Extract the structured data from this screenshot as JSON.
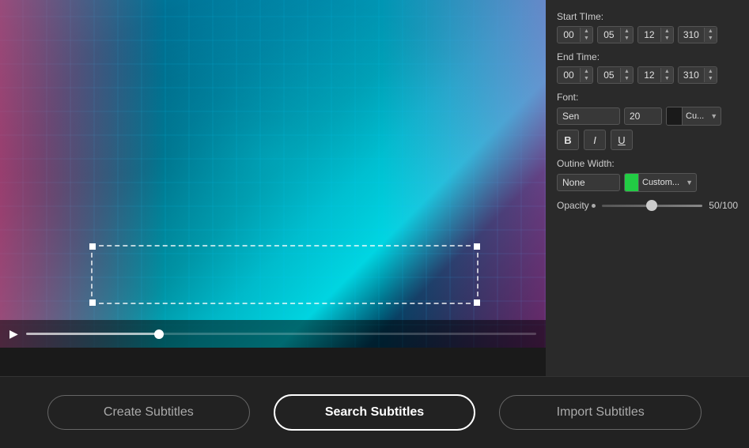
{
  "panel": {
    "start_time": {
      "label": "Start TIme:",
      "h": "00",
      "m": "05",
      "s": "12",
      "ms": "310"
    },
    "end_time": {
      "label": "End Time:",
      "h": "00",
      "m": "05",
      "s": "12",
      "ms": "310"
    },
    "font": {
      "label": "Font:",
      "family": "Sen",
      "size": "20",
      "color_label": "Cu...",
      "bold": "B",
      "italic": "I",
      "underline": "U"
    },
    "outline": {
      "label": "Outine Width:",
      "value": "None",
      "color_label": "Custom..."
    },
    "opacity": {
      "label": "Opacity",
      "value": "50/100"
    }
  },
  "buttons": {
    "create": "Create Subtitles",
    "search": "Search Subtitles",
    "import": "Import Subtitles"
  }
}
